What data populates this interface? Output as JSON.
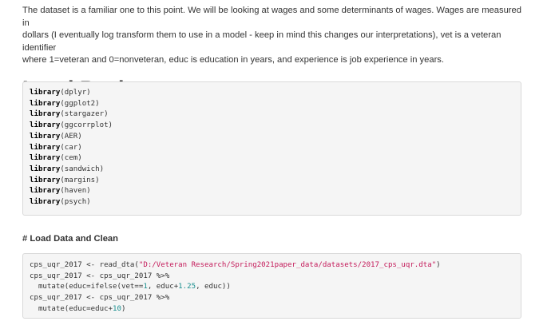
{
  "intro": {
    "line1": "The dataset is a familiar one to this point. We will be looking at wages and some determinants of wages. Wages are measured in",
    "line2": "dollars (I eventually log transform them to use in a model - keep in mind this changes our interpretations), vet is a veteran identifier",
    "line3": "where 1=veteran and 0=nonveteran, educ is education in years, and experience is job experience in years."
  },
  "section_load_packages": {
    "heading": "Load Packages",
    "keyword": "library",
    "packages": [
      "(dplyr)",
      "(ggplot2)",
      "(stargazer)",
      "(ggcorrplot)",
      "(AER)",
      "(car)",
      "(cem)",
      "(sandwich)",
      "(margins)",
      "(haven)",
      "(psych)"
    ]
  },
  "section_load_data": {
    "heading": "# Load Data and Clean",
    "code": {
      "l1_pre": "cps_uqr_2017 <- read_dta(",
      "l1_str": "\"D:/Veteran Research/Spring2021paper_data/datasets/2017_cps_uqr.dta\"",
      "l1_post": ")",
      "l2": "cps_uqr_2017 <- cps_uqr_2017 %>%",
      "l3_pre": "  mutate(educ=ifelse(vet==",
      "l3_num1": "1",
      "l3_mid": ", educ+",
      "l3_num2": "1.25",
      "l3_post": ", educ))",
      "l4": "cps_uqr_2017 <- cps_uqr_2017 %>%",
      "l5_pre": "  mutate(educ=educ+",
      "l5_num": "10",
      "l5_post": ")"
    }
  }
}
